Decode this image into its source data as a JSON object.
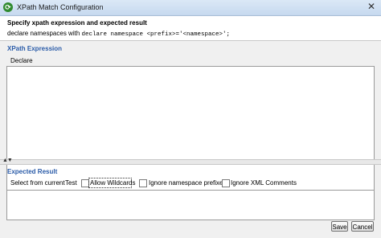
{
  "window": {
    "title": "XPath Match Configuration",
    "close_glyph": "✕"
  },
  "header": {
    "title": "Specify xpath expression and expected result",
    "desc_prefix": "declare namespaces with ",
    "desc_code": "declare namespace <prefix>='<namespace>';"
  },
  "xpath": {
    "section_title": "XPath Expression",
    "declare_button": "Declare",
    "expression_value": ""
  },
  "expected": {
    "section_title": "Expected Result",
    "select_from_current": "Select from current",
    "test": "Test",
    "allow_wildcards": "Allow Wildcards",
    "ignore_ns_prefixes": "Ignore namespace prefixes",
    "ignore_xml_comments": "Ignore XML Comments",
    "result_value": ""
  },
  "splitter": {
    "arrows": "▲▼"
  },
  "buttons": {
    "save": "Save",
    "cancel": "Cancel"
  }
}
